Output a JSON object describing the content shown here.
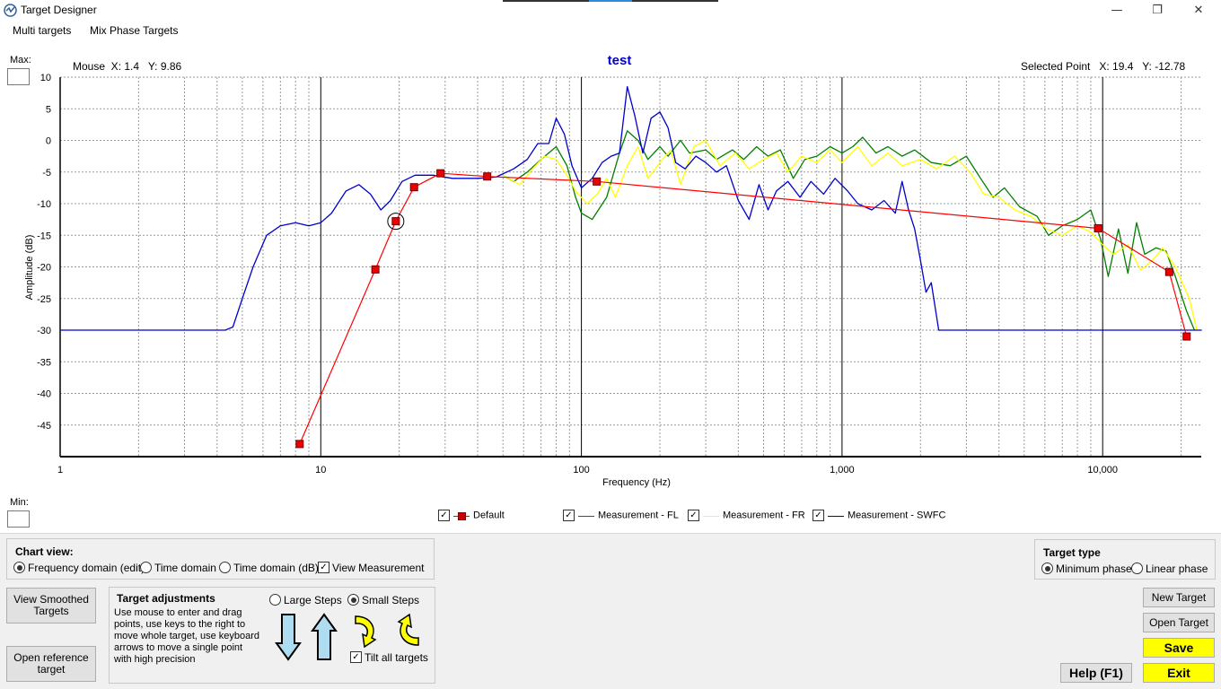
{
  "window": {
    "title": "Target Designer",
    "minimize_glyph": "—",
    "maximize_glyph": "❐",
    "close_glyph": "✕"
  },
  "menu": {
    "items": [
      "Multi targets",
      "Mix Phase Targets"
    ]
  },
  "chart": {
    "title": "test",
    "mouse_readout": "Mouse  X: 1.4   Y: 9.86",
    "selected_readout": "Selected Point   X: 19.4   Y: -12.78",
    "max_label": "Max:",
    "min_label": "Min:",
    "xlabel": "Frequency (Hz)",
    "ylabel": "Amplitude (dB)",
    "colors": {
      "default": "#ff0000",
      "fl": "#008000",
      "fr": "#ffff00",
      "swfc": "#0000cc",
      "marker": "#ff0000",
      "title": "#0000cc"
    }
  },
  "legend": [
    {
      "label": "Default",
      "checked": true,
      "color": "#cc0000"
    },
    {
      "label": "Measurement - FL",
      "checked": true,
      "color": "#008000"
    },
    {
      "label": "Measurement - FR",
      "checked": true,
      "color": "#ffff00"
    },
    {
      "label": "Measurement - SWFC",
      "checked": true,
      "color": "#0000cc"
    }
  ],
  "chart_view": {
    "title": "Chart view:",
    "opt_freq": "Frequency domain (edit)",
    "opt_time": "Time domain",
    "opt_time_db": "Time domain (dB)",
    "opt_view_meas": "View Measurement"
  },
  "target_type": {
    "title": "Target type",
    "opt_min": "Minimum phase",
    "opt_lin": "Linear phase"
  },
  "buttons": {
    "view_smoothed": "View Smoothed Targets",
    "open_reference": "Open reference target",
    "new_target": "New Target",
    "open_target": "Open Target",
    "save": "Save",
    "help": "Help (F1)",
    "exit": "Exit"
  },
  "adjust": {
    "title": "Target adjustments",
    "description": "Use mouse to enter and drag points, use keys to the right to move whole target, use keyboard arrows to move a single point with high precision",
    "opt_large": "Large Steps",
    "opt_small": "Small Steps",
    "tilt_all": "Tilt all targets"
  },
  "chart_data": {
    "type": "line",
    "title": "test",
    "xlabel": "Frequency (Hz)",
    "ylabel": "Amplitude (dB)",
    "x_scale": "log",
    "xlim": [
      1,
      25000
    ],
    "ylim": [
      -50,
      10
    ],
    "x_ticks": [
      1,
      10,
      100,
      1000,
      10000
    ],
    "x_tick_labels": [
      "1",
      "10",
      "100",
      "1,000",
      "10,000"
    ],
    "y_ticks": [
      10,
      5,
      0,
      -5,
      -10,
      -15,
      -20,
      -25,
      -30,
      -35,
      -40,
      -45
    ],
    "grid": true,
    "legend_position": "bottom",
    "series": [
      {
        "name": "Default",
        "color": "#ff0000",
        "markers": true,
        "points": [
          [
            8.3,
            -48.0
          ],
          [
            16.2,
            -20.4
          ],
          [
            19.4,
            -12.78
          ],
          [
            22.8,
            -7.4
          ],
          [
            28.8,
            -5.2
          ],
          [
            43.5,
            -5.7
          ],
          [
            114.5,
            -6.5
          ],
          [
            9600,
            -13.9
          ],
          [
            18000,
            -20.8
          ],
          [
            21000,
            -31.0
          ]
        ]
      },
      {
        "name": "Measurement - FL",
        "color": "#008000",
        "points": [
          [
            50,
            -5.5
          ],
          [
            55,
            -6.5
          ],
          [
            62,
            -5.0
          ],
          [
            70,
            -3.0
          ],
          [
            80,
            -1.0
          ],
          [
            88,
            -4.0
          ],
          [
            95,
            -9.0
          ],
          [
            100,
            -11.5
          ],
          [
            110,
            -12.5
          ],
          [
            125,
            -9.0
          ],
          [
            140,
            -2.0
          ],
          [
            150,
            1.5
          ],
          [
            165,
            0.0
          ],
          [
            180,
            -3.0
          ],
          [
            200,
            -1.0
          ],
          [
            215,
            -2.5
          ],
          [
            240,
            0.0
          ],
          [
            260,
            -2.0
          ],
          [
            300,
            -1.5
          ],
          [
            330,
            -3.0
          ],
          [
            380,
            -1.5
          ],
          [
            420,
            -3.0
          ],
          [
            470,
            -1.0
          ],
          [
            520,
            -2.5
          ],
          [
            580,
            -1.5
          ],
          [
            650,
            -6.0
          ],
          [
            720,
            -3.0
          ],
          [
            800,
            -2.5
          ],
          [
            900,
            -1.0
          ],
          [
            1000,
            -2.0
          ],
          [
            1100,
            -1.0
          ],
          [
            1200,
            0.5
          ],
          [
            1350,
            -2.0
          ],
          [
            1500,
            -1.0
          ],
          [
            1700,
            -2.5
          ],
          [
            1900,
            -1.5
          ],
          [
            2200,
            -3.5
          ],
          [
            2600,
            -4.0
          ],
          [
            3000,
            -2.5
          ],
          [
            3400,
            -6.0
          ],
          [
            3800,
            -9.0
          ],
          [
            4200,
            -7.5
          ],
          [
            4800,
            -10.5
          ],
          [
            5600,
            -12.0
          ],
          [
            6200,
            -15.0
          ],
          [
            7000,
            -13.5
          ],
          [
            8000,
            -12.5
          ],
          [
            9000,
            -11.0
          ],
          [
            9800,
            -15.5
          ],
          [
            10500,
            -21.5
          ],
          [
            11500,
            -14.0
          ],
          [
            12500,
            -21.0
          ],
          [
            13500,
            -13.0
          ],
          [
            14500,
            -18.0
          ],
          [
            16000,
            -17.0
          ],
          [
            17500,
            -17.5
          ],
          [
            19000,
            -21.5
          ],
          [
            21000,
            -27.0
          ],
          [
            22500,
            -30.0
          ]
        ]
      },
      {
        "name": "Measurement - FR",
        "color": "#ffff00",
        "points": [
          [
            50,
            -5.5
          ],
          [
            58,
            -7.0
          ],
          [
            65,
            -4.5
          ],
          [
            72,
            -2.5
          ],
          [
            80,
            -3.0
          ],
          [
            88,
            -5.5
          ],
          [
            95,
            -8.0
          ],
          [
            105,
            -10.0
          ],
          [
            115,
            -8.5
          ],
          [
            125,
            -6.0
          ],
          [
            135,
            -9.0
          ],
          [
            150,
            -4.0
          ],
          [
            165,
            -1.0
          ],
          [
            180,
            -6.0
          ],
          [
            200,
            -3.5
          ],
          [
            220,
            -1.5
          ],
          [
            240,
            -7.0
          ],
          [
            270,
            -1.0
          ],
          [
            300,
            0.0
          ],
          [
            340,
            -4.0
          ],
          [
            390,
            -2.0
          ],
          [
            440,
            -4.5
          ],
          [
            500,
            -3.0
          ],
          [
            560,
            -2.0
          ],
          [
            620,
            -5.0
          ],
          [
            700,
            -2.5
          ],
          [
            800,
            -3.5
          ],
          [
            900,
            -1.5
          ],
          [
            1000,
            -3.5
          ],
          [
            1150,
            -1.0
          ],
          [
            1300,
            -4.0
          ],
          [
            1500,
            -2.0
          ],
          [
            1700,
            -4.0
          ],
          [
            2000,
            -3.0
          ],
          [
            2300,
            -4.5
          ],
          [
            2700,
            -2.5
          ],
          [
            3100,
            -5.0
          ],
          [
            3500,
            -8.5
          ],
          [
            4000,
            -9.0
          ],
          [
            4600,
            -11.0
          ],
          [
            5300,
            -12.0
          ],
          [
            6100,
            -14.0
          ],
          [
            7000,
            -15.0
          ],
          [
            8000,
            -13.5
          ],
          [
            9000,
            -14.5
          ],
          [
            10000,
            -16.5
          ],
          [
            11000,
            -18.0
          ],
          [
            12500,
            -16.5
          ],
          [
            14000,
            -20.5
          ],
          [
            15500,
            -19.0
          ],
          [
            17000,
            -17.0
          ],
          [
            19000,
            -20.0
          ],
          [
            21500,
            -25.0
          ],
          [
            23000,
            -30.0
          ]
        ]
      },
      {
        "name": "Measurement - SWFC",
        "color": "#0000cc",
        "points": [
          [
            1,
            -30.0
          ],
          [
            4.3,
            -30.0
          ],
          [
            4.6,
            -29.5
          ],
          [
            5.0,
            -25.0
          ],
          [
            5.5,
            -20.0
          ],
          [
            6.2,
            -15.0
          ],
          [
            7.0,
            -13.5
          ],
          [
            8.0,
            -13.0
          ],
          [
            9.0,
            -13.5
          ],
          [
            10.0,
            -13.0
          ],
          [
            11.0,
            -11.5
          ],
          [
            12.5,
            -8.0
          ],
          [
            14.0,
            -7.0
          ],
          [
            15.5,
            -8.5
          ],
          [
            17.0,
            -11.0
          ],
          [
            18.5,
            -9.5
          ],
          [
            20.5,
            -6.5
          ],
          [
            23.0,
            -5.5
          ],
          [
            27.0,
            -5.5
          ],
          [
            32.0,
            -6.0
          ],
          [
            40.0,
            -6.0
          ],
          [
            47.0,
            -5.8
          ],
          [
            55.0,
            -4.5
          ],
          [
            62.0,
            -3.0
          ],
          [
            68.0,
            -0.5
          ],
          [
            75.0,
            -0.5
          ],
          [
            80.0,
            3.5
          ],
          [
            86.0,
            1.0
          ],
          [
            92.0,
            -4.0
          ],
          [
            100.0,
            -7.5
          ],
          [
            110.0,
            -6.0
          ],
          [
            120.0,
            -3.5
          ],
          [
            130.0,
            -2.5
          ],
          [
            140.0,
            -2.0
          ],
          [
            150.0,
            8.5
          ],
          [
            160.0,
            4.0
          ],
          [
            172.0,
            -2.0
          ],
          [
            185.0,
            3.5
          ],
          [
            200.0,
            4.5
          ],
          [
            215.0,
            2.0
          ],
          [
            230.0,
            -3.5
          ],
          [
            250.0,
            -4.5
          ],
          [
            275.0,
            -2.5
          ],
          [
            300.0,
            -3.5
          ],
          [
            330.0,
            -5.0
          ],
          [
            360.0,
            -4.0
          ],
          [
            400.0,
            -9.5
          ],
          [
            440.0,
            -12.5
          ],
          [
            480.0,
            -7.0
          ],
          [
            520.0,
            -11.0
          ],
          [
            560.0,
            -8.0
          ],
          [
            620.0,
            -6.5
          ],
          [
            690.0,
            -9.0
          ],
          [
            760.0,
            -6.5
          ],
          [
            850.0,
            -8.5
          ],
          [
            940.0,
            -6.0
          ],
          [
            1050.0,
            -8.0
          ],
          [
            1150.0,
            -10.0
          ],
          [
            1300.0,
            -11.0
          ],
          [
            1450.0,
            -9.5
          ],
          [
            1600.0,
            -11.5
          ],
          [
            1700.0,
            -6.5
          ],
          [
            1800.0,
            -11.0
          ],
          [
            1900.0,
            -14.0
          ],
          [
            2000.0,
            -19.0
          ],
          [
            2100.0,
            -24.0
          ],
          [
            2200.0,
            -22.5
          ],
          [
            2350.0,
            -30.0
          ],
          [
            24000,
            -30.0
          ]
        ]
      }
    ]
  }
}
